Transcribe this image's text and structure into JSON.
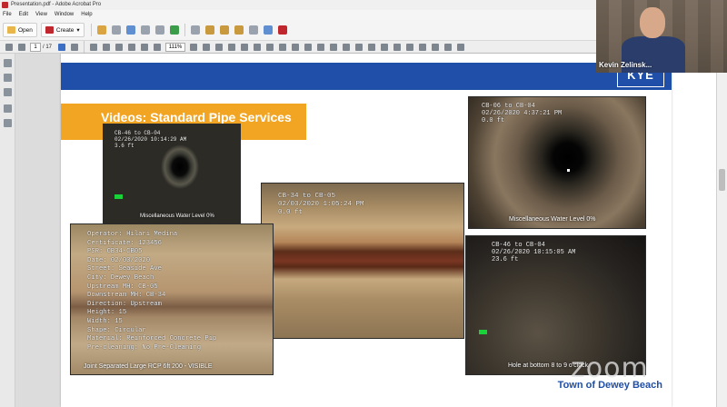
{
  "window": {
    "title": "Presentation.pdf - Adobe Acrobat Pro"
  },
  "menu": [
    "File",
    "Edit",
    "View",
    "Window",
    "Help"
  ],
  "toolbar": {
    "open_label": "Open",
    "create_label": "Create"
  },
  "navigation": {
    "current_page": "1",
    "page_total": "/ 17",
    "zoom": "111%"
  },
  "slide": {
    "title": "Videos: Standard Pipe Services",
    "footer": "Town of Dewey Beach",
    "logo": "KYE"
  },
  "photos": {
    "photo1": {
      "overlay": "CB-46 to CB-04\n02/26/2020 10:14:29 AM\n3.6 ft",
      "caption": "Miscellaneous Water Level 0%"
    },
    "photo2": {
      "overlay": "CB-06 to CB-04\n02/26/2020 4:37:21 PM\n0.0 ft",
      "caption": "Miscellaneous Water Level 0%"
    },
    "photo3": {
      "overlay": "CB-34 to CB-05\n02/03/2020 1:05:24 PM\n0.0 ft"
    },
    "photo4": {
      "overlay": "Operator: Hilari Medina\nCertificate: 123456\nPSR: CB34-CB05\nDate: 02/03/2020\nStreet: Seaside Ave\nCity: Dewey Beach\nUpstream MH: CB-05\nDownstream MH: CB-34\nDirection: Upstream\nHeight: 15\nWidth: 15\nShape: Circular\nMaterial: Reinforced Concrete Pip\nPre-cleaning: No Pre-Cleaning",
      "caption": "Joint Separated Large RCP 6ft 200 - VISIBLE"
    },
    "photo5": {
      "overlay": "CB-46 to CB-04\n02/26/2020 10:15:05 AM\n23.6 ft",
      "caption": "Hole at bottom 8 to 9 o'clock"
    }
  },
  "zoom": {
    "participant_name": "Kevin Zelinsk...",
    "watermark": "zoom"
  },
  "colors": {
    "slide_blue": "#1f4fa8",
    "title_orange": "#f2a423",
    "marker_green": "#19d23a"
  }
}
